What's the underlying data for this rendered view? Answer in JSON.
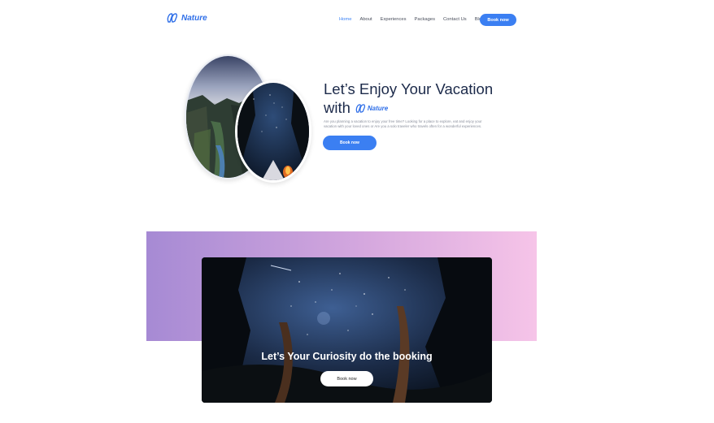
{
  "header": {
    "logo_text": "Nature",
    "nav": [
      "Home",
      "About",
      "Experiences",
      "Packages",
      "Contact Us",
      "Blog"
    ],
    "active_nav": "Home",
    "cta_label": "Book now"
  },
  "hero": {
    "title_line1": "Let’s Enjoy Your Vacation",
    "title_line2_prefix": "with",
    "inline_logo_text": "Nature",
    "description": "Are you planning a vacation to enjoy your free time? Looking for a place to explore, eat and enjoy your vacation with your loved ones or Are you a solo traveler who travels often for a wonderful experiences.",
    "button_label": "Book now"
  },
  "banner": {
    "title": "Let’s Your Curiosity do the booking",
    "button_label": "Book now"
  },
  "colors": {
    "accent": "#3b7ff2",
    "gradient_start": "#a68ad4",
    "gradient_end": "#f6c4e8",
    "heading": "#1c2a4a"
  }
}
